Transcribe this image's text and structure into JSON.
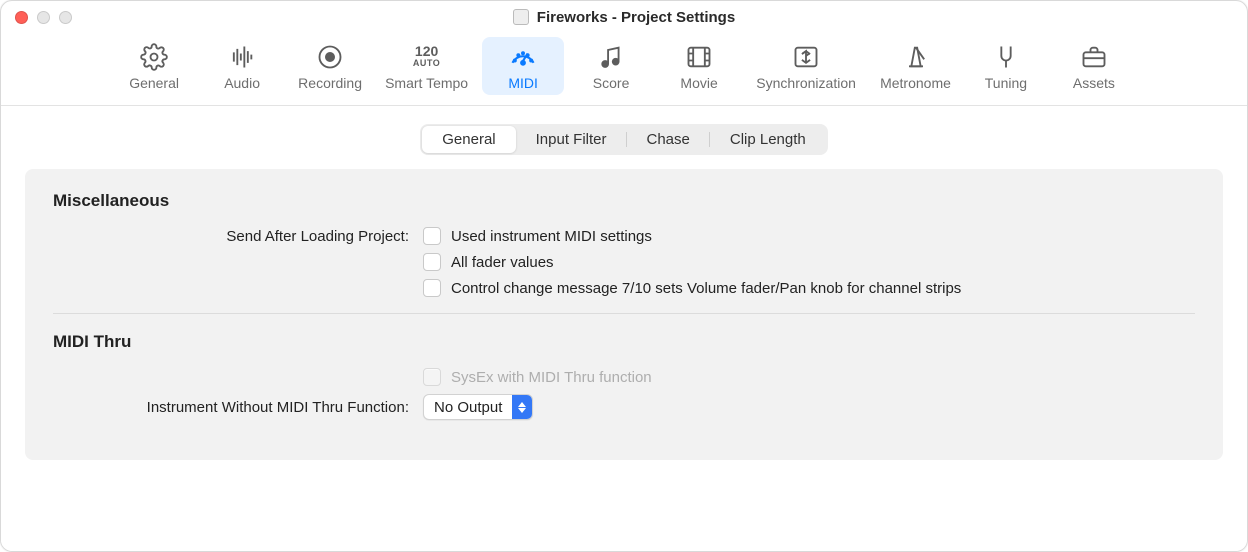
{
  "window": {
    "title": "Fireworks - Project Settings"
  },
  "toolbar": {
    "items": [
      {
        "label": "General"
      },
      {
        "label": "Audio"
      },
      {
        "label": "Recording"
      },
      {
        "label": "Smart Tempo",
        "bpm": "120",
        "auto": "AUTO"
      },
      {
        "label": "MIDI",
        "active": true
      },
      {
        "label": "Score"
      },
      {
        "label": "Movie"
      },
      {
        "label": "Synchronization"
      },
      {
        "label": "Metronome"
      },
      {
        "label": "Tuning"
      },
      {
        "label": "Assets"
      }
    ]
  },
  "subtabs": {
    "items": [
      "General",
      "Input Filter",
      "Chase",
      "Clip Length"
    ],
    "active": "General"
  },
  "sections": {
    "misc": {
      "title": "Miscellaneous",
      "send_label": "Send After Loading Project:",
      "checkbox1": "Used instrument MIDI settings",
      "checkbox2": "All fader values",
      "checkbox3": "Control change message 7/10 sets Volume fader/Pan knob for channel strips"
    },
    "thru": {
      "title": "MIDI Thru",
      "sysex_label": "SysEx with MIDI Thru function",
      "instrument_label": "Instrument Without MIDI Thru Function:",
      "select_value": "No Output"
    }
  }
}
